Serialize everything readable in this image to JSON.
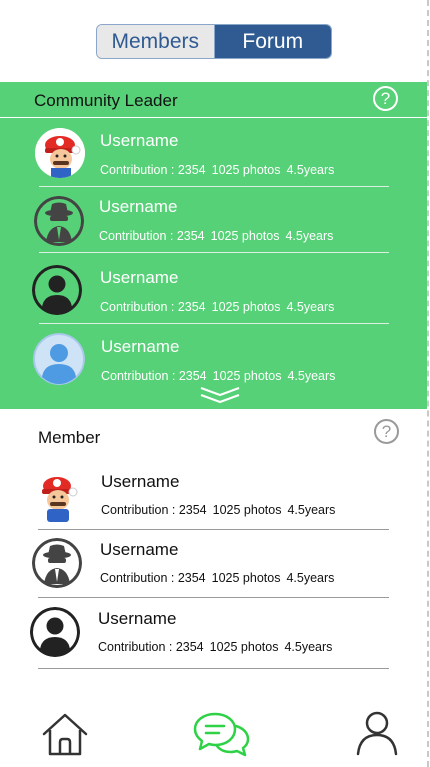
{
  "tabs": {
    "members_label": "Members",
    "forum_label": "Forum",
    "active": "Forum"
  },
  "leaders": {
    "title": "Community Leader",
    "help_symbol": "?",
    "rows": [
      {
        "avatar": "cartoon-mario-avatar",
        "username": "Username",
        "contribution": "Contribution : 2354",
        "photos": "1025 photos",
        "years": "4.5years"
      },
      {
        "avatar": "spy-avatar",
        "username": "Username",
        "contribution": "Contribution : 2354",
        "photos": "1025 photos",
        "years": "4.5years"
      },
      {
        "avatar": "default-user-dark-avatar",
        "username": "Username",
        "contribution": "Contribution : 2354",
        "photos": "1025 photos",
        "years": "4.5years"
      },
      {
        "avatar": "default-user-blue-avatar",
        "username": "Username",
        "contribution": "Contribution : 2354",
        "photos": "1025 photos",
        "years": "4.5years"
      }
    ]
  },
  "members": {
    "title": "Member",
    "help_symbol": "?",
    "rows": [
      {
        "avatar": "cartoon-mario-avatar",
        "username": "Username",
        "contribution": "Contribution : 2354",
        "photos": "1025 photos",
        "years": "4.5years"
      },
      {
        "avatar": "spy-avatar",
        "username": "Username",
        "contribution": "Contribution : 2354",
        "photos": "1025 photos",
        "years": "4.5years"
      },
      {
        "avatar": "default-user-dark-avatar",
        "username": "Username",
        "contribution": "Contribution : 2354",
        "photos": "1025 photos",
        "years": "4.5years"
      }
    ]
  },
  "nav": {
    "items": [
      "home-icon",
      "forum-chat-icon",
      "profile-icon"
    ],
    "active": "forum-chat-icon"
  },
  "colors": {
    "leader_bg": "#56d177",
    "tab_active": "#2f5b92",
    "tab_inactive": "#e8e8e8",
    "nav_active": "#2fd146",
    "nav_inactive": "#333333"
  }
}
